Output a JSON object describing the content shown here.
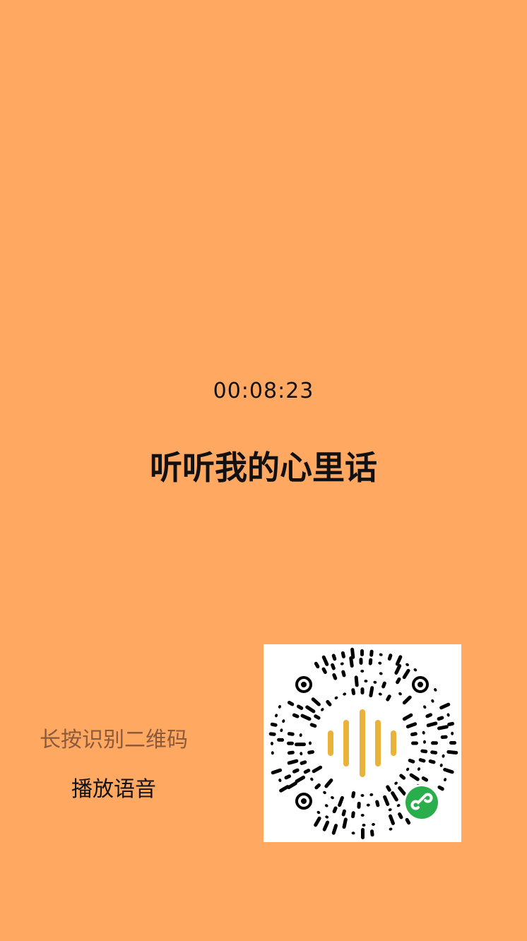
{
  "audio": {
    "duration": "00:08:23"
  },
  "title": "听听我的心里话",
  "qr": {
    "hint": "长按识别二维码",
    "action": "播放语音",
    "icon": "wechat-mini-program-code",
    "colors": {
      "wave": "#EBB239",
      "badge": "#2AAE4C",
      "background": "#FFA862"
    }
  }
}
